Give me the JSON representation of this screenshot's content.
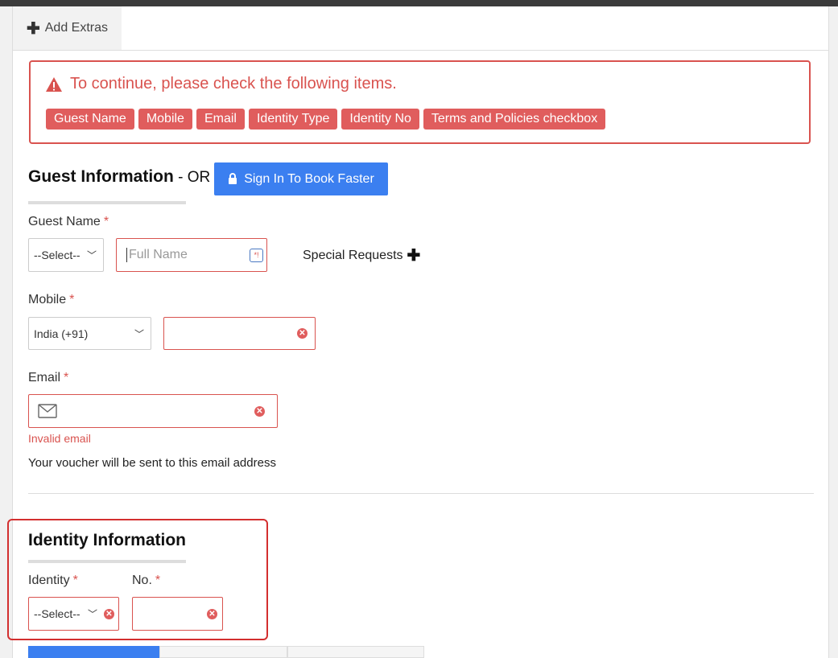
{
  "tabs": {
    "add_extras": "Add Extras"
  },
  "alert": {
    "title": "To continue, please check the following items.",
    "items": [
      "Guest Name",
      "Mobile",
      "Email",
      "Identity Type",
      "Identity No",
      "Terms and Policies checkbox"
    ]
  },
  "guest": {
    "heading": "Guest Information",
    "or": " - OR - ",
    "signin": "Sign In To Book Faster",
    "name_label": "Guest Name",
    "title_select": "--Select--",
    "name_placeholder": "Full Name",
    "special_requests": "Special Requests",
    "mobile_label": "Mobile",
    "country_select": "India (+91)",
    "mobile_value": "",
    "email_label": "Email",
    "email_value": "",
    "email_error": "Invalid email",
    "email_help": "Your voucher will be sent to this email address"
  },
  "identity": {
    "heading": "Identity Information",
    "type_label": "Identity",
    "no_label": "No.",
    "type_select": "--Select--",
    "no_value": ""
  },
  "required_mark": "*",
  "colors": {
    "error": "#d9534f",
    "primary": "#3b7ff0",
    "badge": "#e05d5d"
  }
}
